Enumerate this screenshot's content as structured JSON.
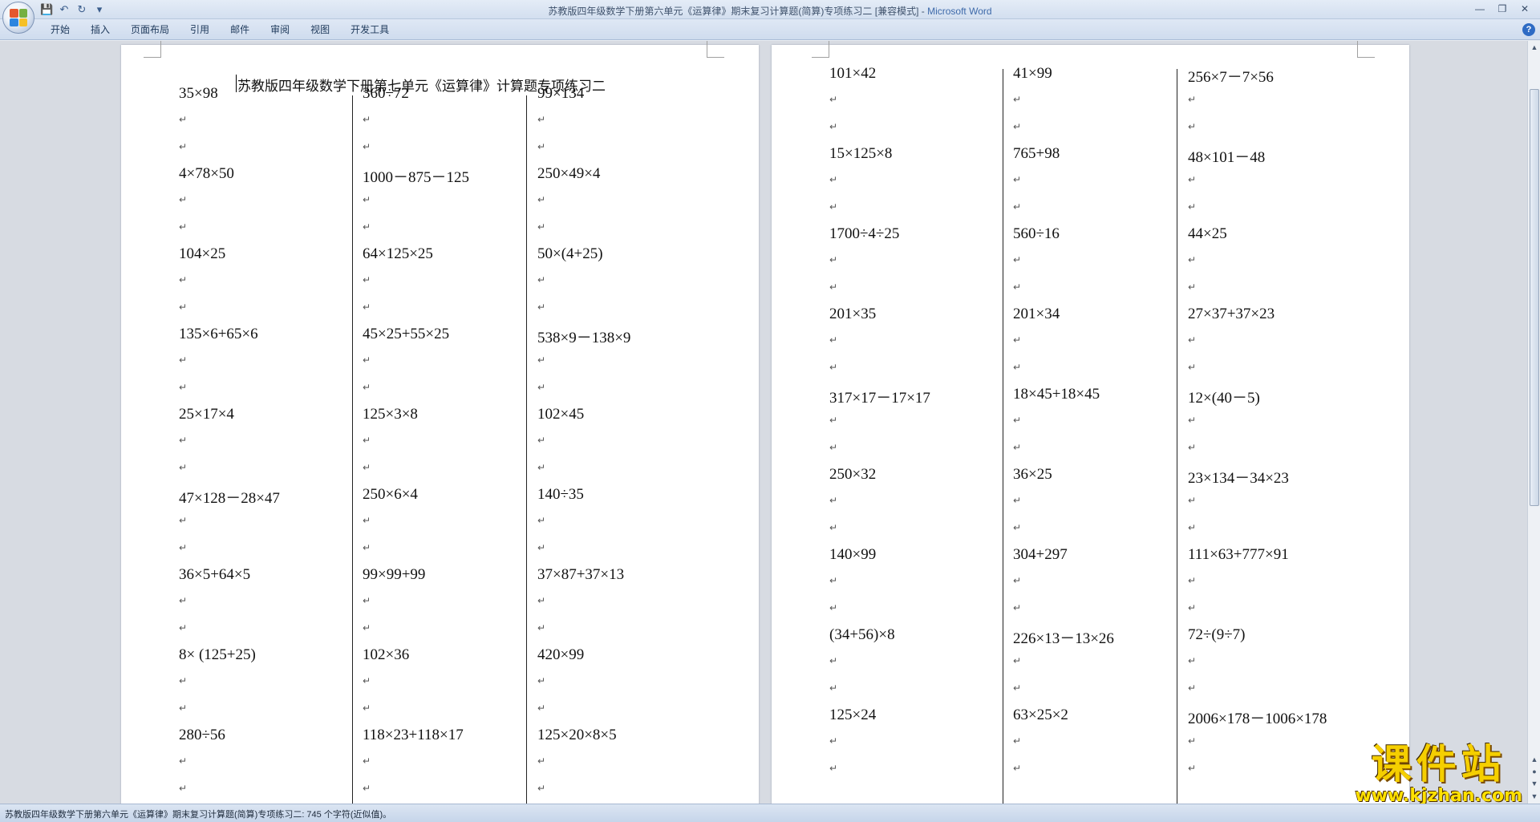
{
  "window": {
    "title_doc": "苏教版四年级数学下册第六单元《运算律》期末复习计算题(简算)专项练习二 [兼容模式] - ",
    "title_app": "Microsoft Word"
  },
  "ribbon": {
    "tabs": [
      "开始",
      "插入",
      "页面布局",
      "引用",
      "邮件",
      "审阅",
      "视图",
      "开发工具"
    ],
    "help": "?"
  },
  "document": {
    "title": "苏教版四年级数学下册第七单元《运算律》计算题专项练习二",
    "page1": {
      "col1": [
        "35×98",
        "4×78×50",
        "104×25",
        "135×6+65×6",
        "25×17×4",
        "47×128－28×47",
        "36×5+64×5",
        "8×  (125+25)",
        "280÷56"
      ],
      "col2": [
        "360÷72",
        "1000－875－125",
        "64×125×25",
        "45×25+55×25",
        "125×3×8",
        "250×6×4",
        "99×99+99",
        "102×36",
        "118×23+118×17"
      ],
      "col3": [
        "99×134",
        "250×49×4",
        "50×(4+25)",
        "538×9－138×9",
        "102×45",
        "140÷35",
        "37×87+37×13",
        "420×99",
        "125×20×8×5"
      ]
    },
    "page2": {
      "col1": [
        "101×42",
        "15×125×8",
        "1700÷4÷25",
        "201×35",
        "317×17－17×17",
        "250×32",
        "140×99",
        " (34+56)×8",
        "125×24"
      ],
      "col2": [
        "41×99",
        "765+98",
        "560÷16",
        "201×34",
        "18×45+18×45",
        "36×25",
        "304+297",
        "226×13－13×26",
        "63×25×2"
      ],
      "col3": [
        "256×7－7×56",
        "48×101－48",
        "44×25",
        "27×37+37×23",
        "12×(40－5)",
        "23×134－34×23",
        "111×63+777×91",
        "72÷(9÷7)",
        "2006×178－1006×178"
      ]
    }
  },
  "status": {
    "text": "苏教版四年级数学下册第六单元《运算律》期末复习计算题(简算)专项练习二: 745 个字符(近似值)。"
  },
  "watermark": {
    "title": "课件站",
    "url": "www.kjzhan.com"
  },
  "colors": {
    "accent": "#3e6aaa",
    "watermark": "#f5cf00"
  }
}
